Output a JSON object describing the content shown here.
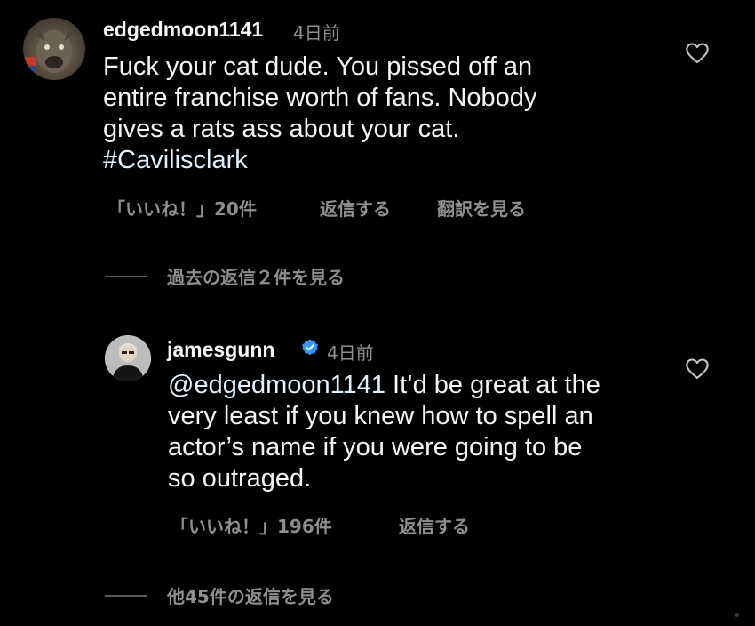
{
  "comment1": {
    "username": "edgedmoon1141",
    "time": "4日前",
    "lines": [
      "Fuck your cat dude. You pissed off an",
      "entire franchise worth of fans. Nobody",
      "gives a rats ass about your cat."
    ],
    "hashtag": "#Cavilisclark",
    "likes": "「いいね！」20件",
    "reply_label": "返信する",
    "translate_label": "翻訳を見る",
    "icons": {
      "avatar": "avatar",
      "heart": "heart-icon"
    }
  },
  "view_previous_replies": "過去の返信２件を見る",
  "comment2": {
    "username": "jamesgunn",
    "time": "4日前",
    "mention": "@edgedmoon1141",
    "first_line_rest": " It’d be great at the",
    "lines": [
      "very least if you knew how to spell an",
      "actor’s name if you were going to be",
      "so outraged."
    ],
    "likes": "「いいね！」196件",
    "reply_label": "返信する",
    "icons": {
      "verified": "verified-badge-icon",
      "heart": "heart-icon"
    }
  },
  "view_more_replies": "他45件の返信を見る",
  "colors": {
    "background": "#000000",
    "text": "#f5f5f5",
    "muted": "#8e8e8e",
    "verified": "#3897f0",
    "link": "#e0f1ff"
  }
}
